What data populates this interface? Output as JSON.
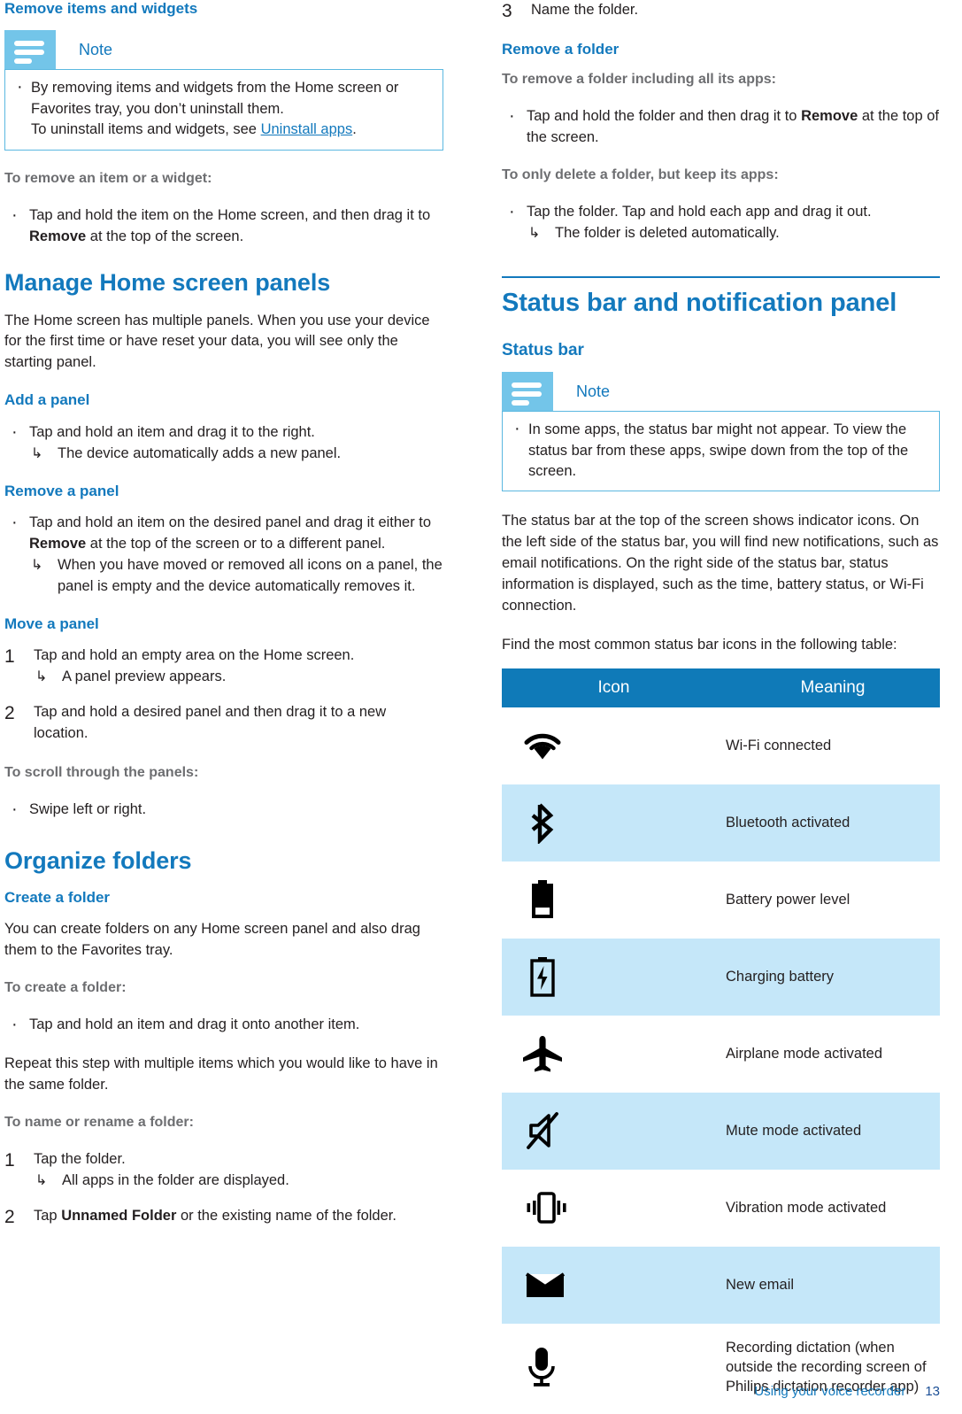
{
  "colors": {
    "heading_blue": "#1379bd",
    "note_icon_blue": "#73c5e9",
    "note_border": "#5bb8e0",
    "table_header_blue": "#0f7ab8",
    "table_alt_row": "#c5e7f9",
    "lead_gray": "#6d6e71",
    "page_number": "#1b4f96"
  },
  "left_column": {
    "heading_remove_items": "Remove items and widgets",
    "note1": {
      "title": "Note",
      "icon": "note-lines-icon",
      "items": [
        {
          "pre": "By removing items and widgets from the Home screen or Favorites tray, you don’t uninstall them.",
          "line2_pre": "To uninstall items and widgets, see ",
          "link": "Uninstall apps",
          "post": "."
        }
      ]
    },
    "lead_remove_item": "To remove an item or a widget:",
    "bullet_remove_item": {
      "pre": "Tap and hold the item on the Home screen, and then drag it to ",
      "bold": "Remove",
      "post": " at the top of the screen."
    },
    "heading_manage_panels": "Manage Home screen panels",
    "para_panels": "The Home screen has multiple panels. When you use your device for the first time or have reset your data, you will see only the starting panel.",
    "sub_add_panel": "Add a panel",
    "bullet_add_panel": "Tap and hold an item and drag it to the right.",
    "arrow_add_panel": "The device automatically adds a new panel.",
    "sub_remove_panel": "Remove a panel",
    "bullet_remove_panel": {
      "pre": "Tap and hold an item on the desired panel and drag it either to ",
      "bold": "Remove",
      "post": " at the top of the screen or to a different panel."
    },
    "arrow_remove_panel": "When you have moved or removed all icons on a panel, the panel is empty and the device automatically removes it.",
    "sub_move_panel": "Move a panel",
    "steps_move_panel": [
      {
        "num": "1",
        "text": "Tap and hold an empty area on the Home screen.",
        "arrow": "A panel preview appears."
      },
      {
        "num": "2",
        "text": "Tap and hold a desired panel and then drag it to a new location.",
        "arrow": ""
      }
    ],
    "lead_scroll_panels": "To scroll through the panels:",
    "bullet_scroll": "Swipe left or right.",
    "heading_organize_folders": "Organize folders",
    "sub_create_folder": "Create a folder",
    "para_create_folder": "You can create folders on any Home screen panel and also drag them to the Favorites tray.",
    "lead_create_folder": "To create a folder:",
    "bullet_create_folder": "Tap and hold an item and drag it onto another item.",
    "para_repeat": "Repeat this step with multiple items which you would like to have in the same folder.",
    "lead_name_folder": "To name or rename a folder:",
    "steps_name_folder": [
      {
        "num": "1",
        "text": "Tap the folder.",
        "arrow": "All apps in the folder are displayed."
      },
      {
        "num": "2",
        "pre": "Tap ",
        "bold": "Unnamed Folder",
        "post": " or the existing name of the folder.",
        "arrow": ""
      }
    ]
  },
  "right_column": {
    "step3": {
      "num": "3",
      "text": "Name the folder."
    },
    "sub_remove_folder": "Remove a folder",
    "lead_remove_folder_apps": "To remove a folder including all its apps:",
    "bullet_remove_folder": {
      "pre": "Tap and hold the folder and then drag it to ",
      "bold": "Remove",
      "post": " at the top of the screen."
    },
    "lead_delete_folder": "To only delete a folder, but keep its apps:",
    "bullet_delete_folder": "Tap the folder. Tap and hold each app and drag it out.",
    "arrow_delete_folder": "The folder is deleted automatically.",
    "heading_status_bar_panel": "Status bar and notification panel",
    "sub_status_bar": "Status bar",
    "note2": {
      "title": "Note",
      "icon": "note-lines-icon",
      "items": [
        "In some apps, the status bar might not appear. To view the status bar from these apps, swipe down from the top of the screen."
      ]
    },
    "para_status_bar": "The status bar at the top of the screen shows indicator icons. On the left side of the status bar, you will find new notifications, such as email notifications. On the right side of the status bar, status information is displayed, such as the time, battery status, or Wi-Fi connection.",
    "para_find_icons": "Find the most common status bar icons in the following table:",
    "table": {
      "headers": [
        "Icon",
        "Meaning"
      ],
      "rows": [
        {
          "icon": "wifi-icon",
          "meaning": "Wi-Fi connected"
        },
        {
          "icon": "bluetooth-icon",
          "meaning": "Bluetooth activated"
        },
        {
          "icon": "battery-level-icon",
          "meaning": "Battery power level"
        },
        {
          "icon": "battery-charging-icon",
          "meaning": "Charging battery"
        },
        {
          "icon": "airplane-icon",
          "meaning": "Airplane mode activated"
        },
        {
          "icon": "mute-icon",
          "meaning": "Mute mode activated"
        },
        {
          "icon": "vibration-icon",
          "meaning": "Vibration mode activated"
        },
        {
          "icon": "envelope-icon",
          "meaning": "New email"
        },
        {
          "icon": "microphone-icon",
          "meaning": "Recording dictation (when outside the recording screen of Philips dictation recorder app)"
        }
      ]
    }
  },
  "footer": {
    "chapter": "Using your voice recorder",
    "page_number": "13"
  }
}
